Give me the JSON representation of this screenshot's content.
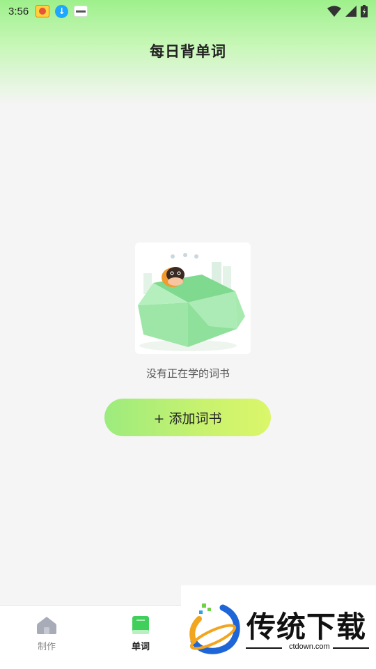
{
  "status_bar": {
    "time": "3:56"
  },
  "header": {
    "title": "每日背单词"
  },
  "empty_state": {
    "message": "没有正在学的词书",
    "add_button_label": "+ 添加词书"
  },
  "bottom_nav": {
    "items": [
      {
        "label": "制作",
        "icon": "home-icon",
        "active": false
      },
      {
        "label": "单词",
        "icon": "book-icon",
        "active": true
      }
    ]
  },
  "watermark": {
    "brand": "传统下载",
    "url": "ctdown.com"
  },
  "colors": {
    "accent_green": "#9ceb7e",
    "accent_lime": "#dbf66a",
    "nav_active": "#3fcf5a",
    "nav_inactive": "#a8acb8"
  }
}
